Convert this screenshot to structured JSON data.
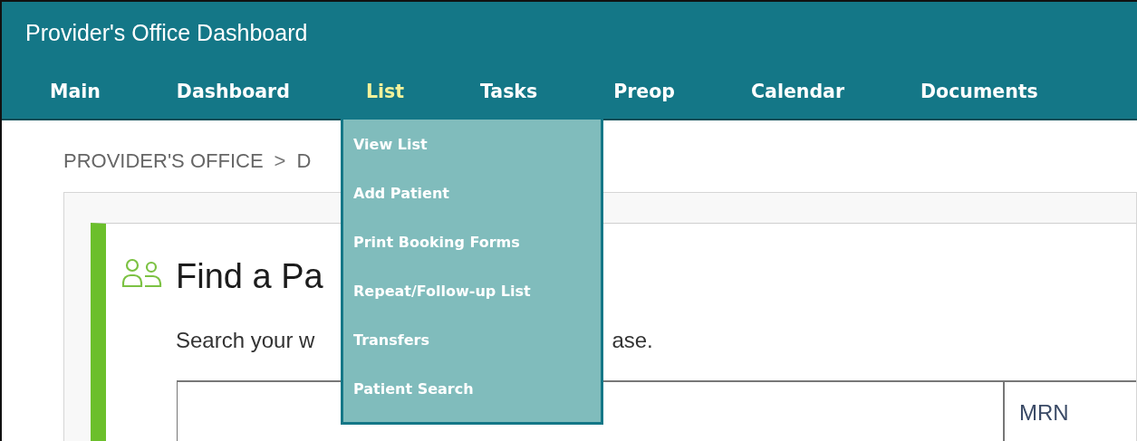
{
  "header": {
    "title": "Provider's Office Dashboard"
  },
  "nav": [
    {
      "label": "Main",
      "selected": false
    },
    {
      "label": "Dashboard",
      "selected": false
    },
    {
      "label": "List",
      "selected": true
    },
    {
      "label": "Tasks",
      "selected": false
    },
    {
      "label": "Preop",
      "selected": false
    },
    {
      "label": "Calendar",
      "selected": false
    },
    {
      "label": "Documents",
      "selected": false
    }
  ],
  "dropdown": {
    "items": [
      "View List",
      "Add Patient",
      "Print Booking Forms",
      "Repeat/Follow-up List",
      "Transfers",
      "Patient Search"
    ]
  },
  "breadcrumb": {
    "items": [
      "PROVIDER'S OFFICE",
      "D"
    ],
    "separator": ">"
  },
  "panel": {
    "title": "Find a Pa",
    "subtitle_parts": [
      "Search your w",
      "ase."
    ]
  },
  "table": {
    "columns": [
      "MRN"
    ]
  }
}
